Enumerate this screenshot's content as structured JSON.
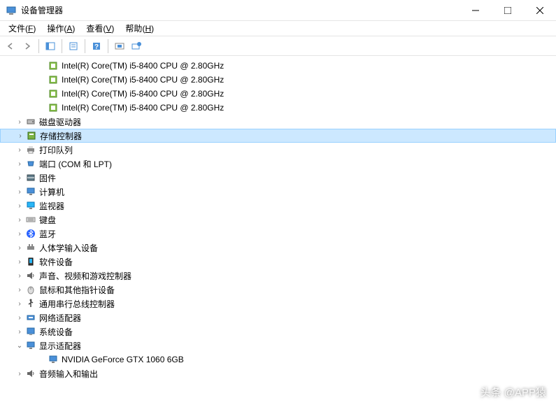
{
  "window": {
    "title": "设备管理器"
  },
  "menu": {
    "file": {
      "label": "文件",
      "hotkey": "F"
    },
    "action": {
      "label": "操作",
      "hotkey": "A"
    },
    "view": {
      "label": "查看",
      "hotkey": "V"
    },
    "help": {
      "label": "帮助",
      "hotkey": "H"
    }
  },
  "devices": {
    "cpu0": "Intel(R) Core(TM) i5-8400 CPU @ 2.80GHz",
    "cpu1": "Intel(R) Core(TM) i5-8400 CPU @ 2.80GHz",
    "cpu2": "Intel(R) Core(TM) i5-8400 CPU @ 2.80GHz",
    "cpu3": "Intel(R) Core(TM) i5-8400 CPU @ 2.80GHz",
    "disk": "磁盘驱动器",
    "storage": "存储控制器",
    "print": "打印队列",
    "ports": "端口 (COM 和 LPT)",
    "firmware": "固件",
    "computer": "计算机",
    "monitor": "监视器",
    "keyboard": "键盘",
    "bluetooth": "蓝牙",
    "hid": "人体学输入设备",
    "software": "软件设备",
    "sound": "声音、视频和游戏控制器",
    "mouse": "鼠标和其他指针设备",
    "usb": "通用串行总线控制器",
    "network": "网络适配器",
    "system": "系统设备",
    "display": "显示适配器",
    "gpu": "NVIDIA GeForce GTX 1060 6GB",
    "audio": "音频输入和输出"
  },
  "watermark": "头条 @APP猿"
}
